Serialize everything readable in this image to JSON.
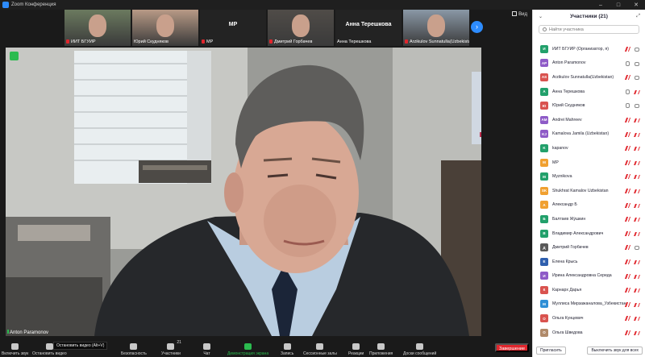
{
  "window": {
    "title": "Zoom Конференция"
  },
  "strip": {
    "view_label": "Вид",
    "tiles": [
      {
        "name": "ИИТ БГУИР",
        "muted": true,
        "video": true
      },
      {
        "name": "Юрий Скудняков",
        "muted": false,
        "video": true
      },
      {
        "name": "МР",
        "muted": true,
        "video": false,
        "big": "МР"
      },
      {
        "name": "Дмитрий Горбачев",
        "muted": true,
        "video": true
      },
      {
        "name": "Анна Терешкова",
        "muted": false,
        "video": false,
        "big": "Анна Терешкова"
      },
      {
        "name": "Arzikulov Sunnatulla(Uzbekistan)",
        "muted": true,
        "video": true
      }
    ]
  },
  "main": {
    "speaker": "Anton Paramonov"
  },
  "toolbar": {
    "tooltip": "Остановить видео (Alt+V)",
    "items": [
      {
        "key": "audio",
        "label": "Включить звук"
      },
      {
        "key": "video",
        "label": "Остановить видео"
      },
      {
        "key": "security",
        "label": "Безопасность"
      },
      {
        "key": "participants",
        "label": "Участники",
        "count": "21"
      },
      {
        "key": "chat",
        "label": "Чат"
      },
      {
        "key": "share",
        "label": "Демонстрация экрана"
      },
      {
        "key": "record",
        "label": "Запись"
      },
      {
        "key": "rooms",
        "label": "Сессионные залы"
      },
      {
        "key": "reactions",
        "label": "Реакции"
      },
      {
        "key": "apps",
        "label": "Приложения"
      },
      {
        "key": "whiteboard",
        "label": "Доски сообщений"
      }
    ],
    "end_label": "Завершение"
  },
  "panel": {
    "title": "Участники (21)",
    "search_placeholder": "Найти участника",
    "participants": [
      {
        "initials": "И",
        "color": "#22a06b",
        "name": "ИИТ БГУИР (Организатор, я)",
        "mic": "muted",
        "cam": "on"
      },
      {
        "initials": "AP",
        "color": "#8e5bc7",
        "name": "Anton Paramonov",
        "mic": "on",
        "cam": "on"
      },
      {
        "initials": "AS",
        "color": "#d9534f",
        "name": "Arzikulov Sunnatulla(Uzbekistan)",
        "mic": "muted",
        "cam": "on"
      },
      {
        "initials": "А",
        "color": "#22a06b",
        "name": "Анна Терешкова",
        "mic": "on",
        "cam": "muted"
      },
      {
        "initials": "Ю",
        "color": "#d9534f",
        "name": "Юрий Скудняков",
        "mic": "on",
        "cam": "on"
      },
      {
        "initials": "AM",
        "color": "#8e5bc7",
        "name": "Andrei Mahreev",
        "mic": "muted",
        "cam": "muted"
      },
      {
        "initials": "KJ",
        "color": "#8e5bc7",
        "name": "Kamalova Jamila (Uzbekistan)",
        "mic": "muted",
        "cam": "muted"
      },
      {
        "initials": "K",
        "color": "#22a06b",
        "name": "kapanov",
        "mic": "muted",
        "cam": "muted"
      },
      {
        "initials": "M",
        "color": "#f0a030",
        "name": "МР",
        "mic": "muted",
        "cam": "muted"
      },
      {
        "initials": "M",
        "color": "#22a06b",
        "name": "Myznikova",
        "mic": "muted",
        "cam": "muted"
      },
      {
        "initials": "SK",
        "color": "#f0a030",
        "name": "Shukhrat Kamalov Uzbekistan",
        "mic": "muted",
        "cam": "muted"
      },
      {
        "initials": "А",
        "color": "#f0a030",
        "name": "Александр Б",
        "mic": "muted",
        "cam": "muted"
      },
      {
        "initials": "Б",
        "color": "#22a06b",
        "name": "Балтаев Жўшкин",
        "mic": "muted",
        "cam": "muted"
      },
      {
        "initials": "В",
        "color": "#22a06b",
        "name": "Владимир Александрович",
        "mic": "muted",
        "cam": "muted"
      },
      {
        "initials": "Д",
        "color": "#5a5a5a",
        "name": "Дмитрий Горбачев",
        "mic": "muted",
        "cam": "on"
      },
      {
        "initials": "Е",
        "color": "#2f5fae",
        "name": "Елена Крысь",
        "mic": "muted",
        "cam": "muted"
      },
      {
        "initials": "И",
        "color": "#8e5bc7",
        "name": "Ирина Александровна Середа",
        "mic": "muted",
        "cam": "muted"
      },
      {
        "initials": "К",
        "color": "#d9534f",
        "name": "Карнарх Дарья",
        "mic": "muted",
        "cam": "muted"
      },
      {
        "initials": "М",
        "color": "#2f8fd6",
        "name": "Муллиса Мирзажаналова_Узбекистан",
        "mic": "muted",
        "cam": "muted"
      },
      {
        "initials": "О",
        "color": "#d9534f",
        "name": "Ольга Кунцевич",
        "mic": "muted",
        "cam": "muted"
      },
      {
        "initials": "О",
        "color": "#b08a6a",
        "name": "Ольга Шведова",
        "mic": "muted",
        "cam": "muted"
      }
    ],
    "invite_label": "Пригласить",
    "mute_all_label": "Выключить звук для всех"
  }
}
